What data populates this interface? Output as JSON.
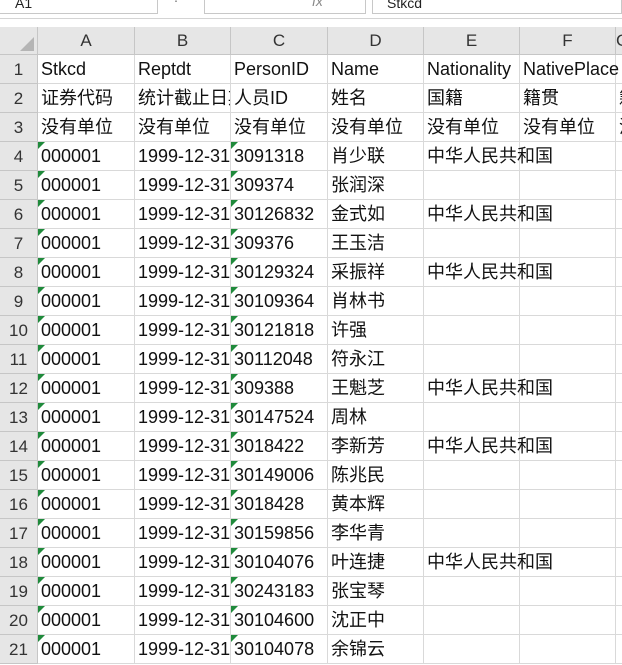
{
  "formula_bar": {
    "name_box": "A1",
    "formula_icon": "fx",
    "formula_value": "Stkcd"
  },
  "columns": [
    "A",
    "B",
    "C",
    "D",
    "E",
    "F",
    "G"
  ],
  "rows": [
    {
      "num": "1",
      "cells": [
        "Stkcd",
        "Reptdt",
        "PersonID",
        "Name",
        "Nationality",
        "NativePlace",
        ""
      ]
    },
    {
      "num": "2",
      "cells": [
        "证券代码",
        "统计截止日期",
        "人员ID",
        "姓名",
        "国籍",
        "籍贯",
        "籍"
      ]
    },
    {
      "num": "3",
      "cells": [
        "没有单位",
        "没有单位",
        "没有单位",
        "没有单位",
        "没有单位",
        "没有单位",
        "没"
      ]
    },
    {
      "num": "4",
      "cells": [
        "000001",
        "1999-12-31",
        "3091318",
        "肖少联",
        "中华人民共和国",
        "",
        ""
      ]
    },
    {
      "num": "5",
      "cells": [
        "000001",
        "1999-12-31",
        "309374",
        "张润深",
        "",
        "",
        ""
      ]
    },
    {
      "num": "6",
      "cells": [
        "000001",
        "1999-12-31",
        "30126832",
        "金式如",
        "中华人民共和国",
        "",
        ""
      ]
    },
    {
      "num": "7",
      "cells": [
        "000001",
        "1999-12-31",
        "309376",
        "王玉洁",
        "",
        "",
        ""
      ]
    },
    {
      "num": "8",
      "cells": [
        "000001",
        "1999-12-31",
        "30129324",
        "采振祥",
        "中华人民共和国",
        "",
        ""
      ]
    },
    {
      "num": "9",
      "cells": [
        "000001",
        "1999-12-31",
        "30109364",
        "肖林书",
        "",
        "",
        ""
      ]
    },
    {
      "num": "10",
      "cells": [
        "000001",
        "1999-12-31",
        "30121818",
        "许强",
        "",
        "",
        ""
      ]
    },
    {
      "num": "11",
      "cells": [
        "000001",
        "1999-12-31",
        "30112048",
        "符永江",
        "",
        "",
        ""
      ]
    },
    {
      "num": "12",
      "cells": [
        "000001",
        "1999-12-31",
        "309388",
        "王魁芝",
        "中华人民共和国",
        "",
        ""
      ]
    },
    {
      "num": "13",
      "cells": [
        "000001",
        "1999-12-31",
        "30147524",
        "周林",
        "",
        "",
        ""
      ]
    },
    {
      "num": "14",
      "cells": [
        "000001",
        "1999-12-31",
        "3018422",
        "李新芳",
        "中华人民共和国",
        "",
        ""
      ]
    },
    {
      "num": "15",
      "cells": [
        "000001",
        "1999-12-31",
        "30149006",
        "陈兆民",
        "",
        "",
        ""
      ]
    },
    {
      "num": "16",
      "cells": [
        "000001",
        "1999-12-31",
        "3018428",
        "黄本辉",
        "",
        "",
        ""
      ]
    },
    {
      "num": "17",
      "cells": [
        "000001",
        "1999-12-31",
        "30159856",
        "李华青",
        "",
        "",
        ""
      ]
    },
    {
      "num": "18",
      "cells": [
        "000001",
        "1999-12-31",
        "30104076",
        "叶连捷",
        "中华人民共和国",
        "",
        ""
      ]
    },
    {
      "num": "19",
      "cells": [
        "000001",
        "1999-12-31",
        "30243183",
        "张宝琴",
        "",
        "",
        ""
      ]
    },
    {
      "num": "20",
      "cells": [
        "000001",
        "1999-12-31",
        "30104600",
        "沈正中",
        "",
        "",
        ""
      ]
    },
    {
      "num": "21",
      "cells": [
        "000001",
        "1999-12-31",
        "30104078",
        "余锦云",
        "",
        "",
        ""
      ]
    }
  ],
  "colors": {
    "header_bg": "#e6e6e6",
    "gridline": "#d9d9d9",
    "text_as_number_indicator": "#1f8a3b"
  }
}
